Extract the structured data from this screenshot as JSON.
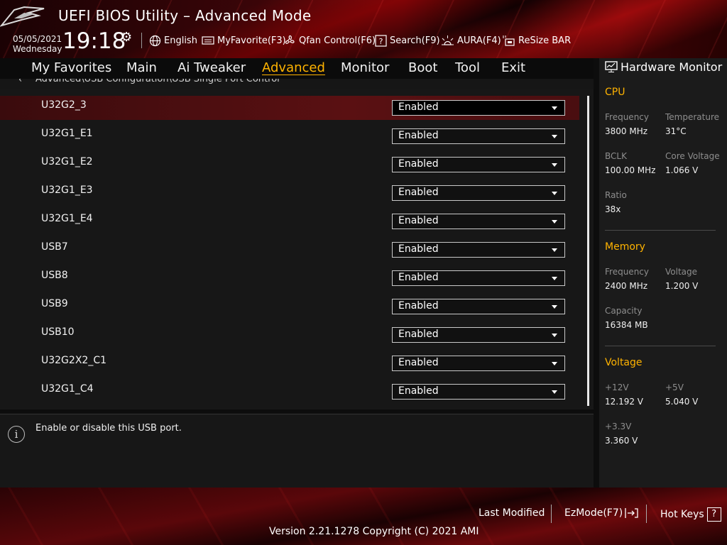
{
  "app": {
    "title": "UEFI BIOS Utility – Advanced Mode"
  },
  "status": {
    "date": "05/05/2021",
    "day": "Wednesday",
    "time": "19:18"
  },
  "toolbar": {
    "language": "English",
    "myfavorite": "MyFavorite(F3)",
    "qfan": "Qfan Control(F6)",
    "search": "Search(F9)",
    "aura": "AURA(F4)",
    "resize_bar": "ReSize BAR"
  },
  "nav": {
    "tabs": [
      "My Favorites",
      "Main",
      "Ai Tweaker",
      "Advanced",
      "Monitor",
      "Boot",
      "Tool",
      "Exit"
    ],
    "active": "Advanced"
  },
  "breadcrumb": "Advanced\\USB Configuration\\USB Single Port Control",
  "ports": [
    {
      "name": "U32G2_3",
      "value": "Enabled"
    },
    {
      "name": "U32G1_E1",
      "value": "Enabled"
    },
    {
      "name": "U32G1_E2",
      "value": "Enabled"
    },
    {
      "name": "U32G1_E3",
      "value": "Enabled"
    },
    {
      "name": "U32G1_E4",
      "value": "Enabled"
    },
    {
      "name": "USB7",
      "value": "Enabled"
    },
    {
      "name": "USB8",
      "value": "Enabled"
    },
    {
      "name": "USB9",
      "value": "Enabled"
    },
    {
      "name": "USB10",
      "value": "Enabled"
    },
    {
      "name": "U32G2X2_C1",
      "value": "Enabled"
    },
    {
      "name": "U32G1_C4",
      "value": "Enabled"
    }
  ],
  "help": {
    "text": "Enable or disable this USB port."
  },
  "hardware_monitor": {
    "title": "Hardware Monitor",
    "cpu": {
      "heading": "CPU",
      "frequency_label": "Frequency",
      "frequency": "3800 MHz",
      "temperature_label": "Temperature",
      "temperature": "31°C",
      "bclk_label": "BCLK",
      "bclk": "100.00 MHz",
      "core_voltage_label": "Core Voltage",
      "core_voltage": "1.066 V",
      "ratio_label": "Ratio",
      "ratio": "38x"
    },
    "memory": {
      "heading": "Memory",
      "frequency_label": "Frequency",
      "frequency": "2400 MHz",
      "voltage_label": "Voltage",
      "voltage": "1.200 V",
      "capacity_label": "Capacity",
      "capacity": "16384 MB"
    },
    "voltage": {
      "heading": "Voltage",
      "v12_label": "+12V",
      "v12": "12.192 V",
      "v5_label": "+5V",
      "v5": "5.040 V",
      "v33_label": "+3.3V",
      "v33": "3.360 V"
    }
  },
  "footer": {
    "last_modified": "Last Modified",
    "ezmode": "EzMode(F7)",
    "hotkeys": "Hot Keys",
    "version": "Version 2.21.1278 Copyright (C) 2021 AMI"
  },
  "colors": {
    "accent": "#ffb300",
    "selected_row": "#5a1012",
    "brand_red": "#8a0c10"
  }
}
